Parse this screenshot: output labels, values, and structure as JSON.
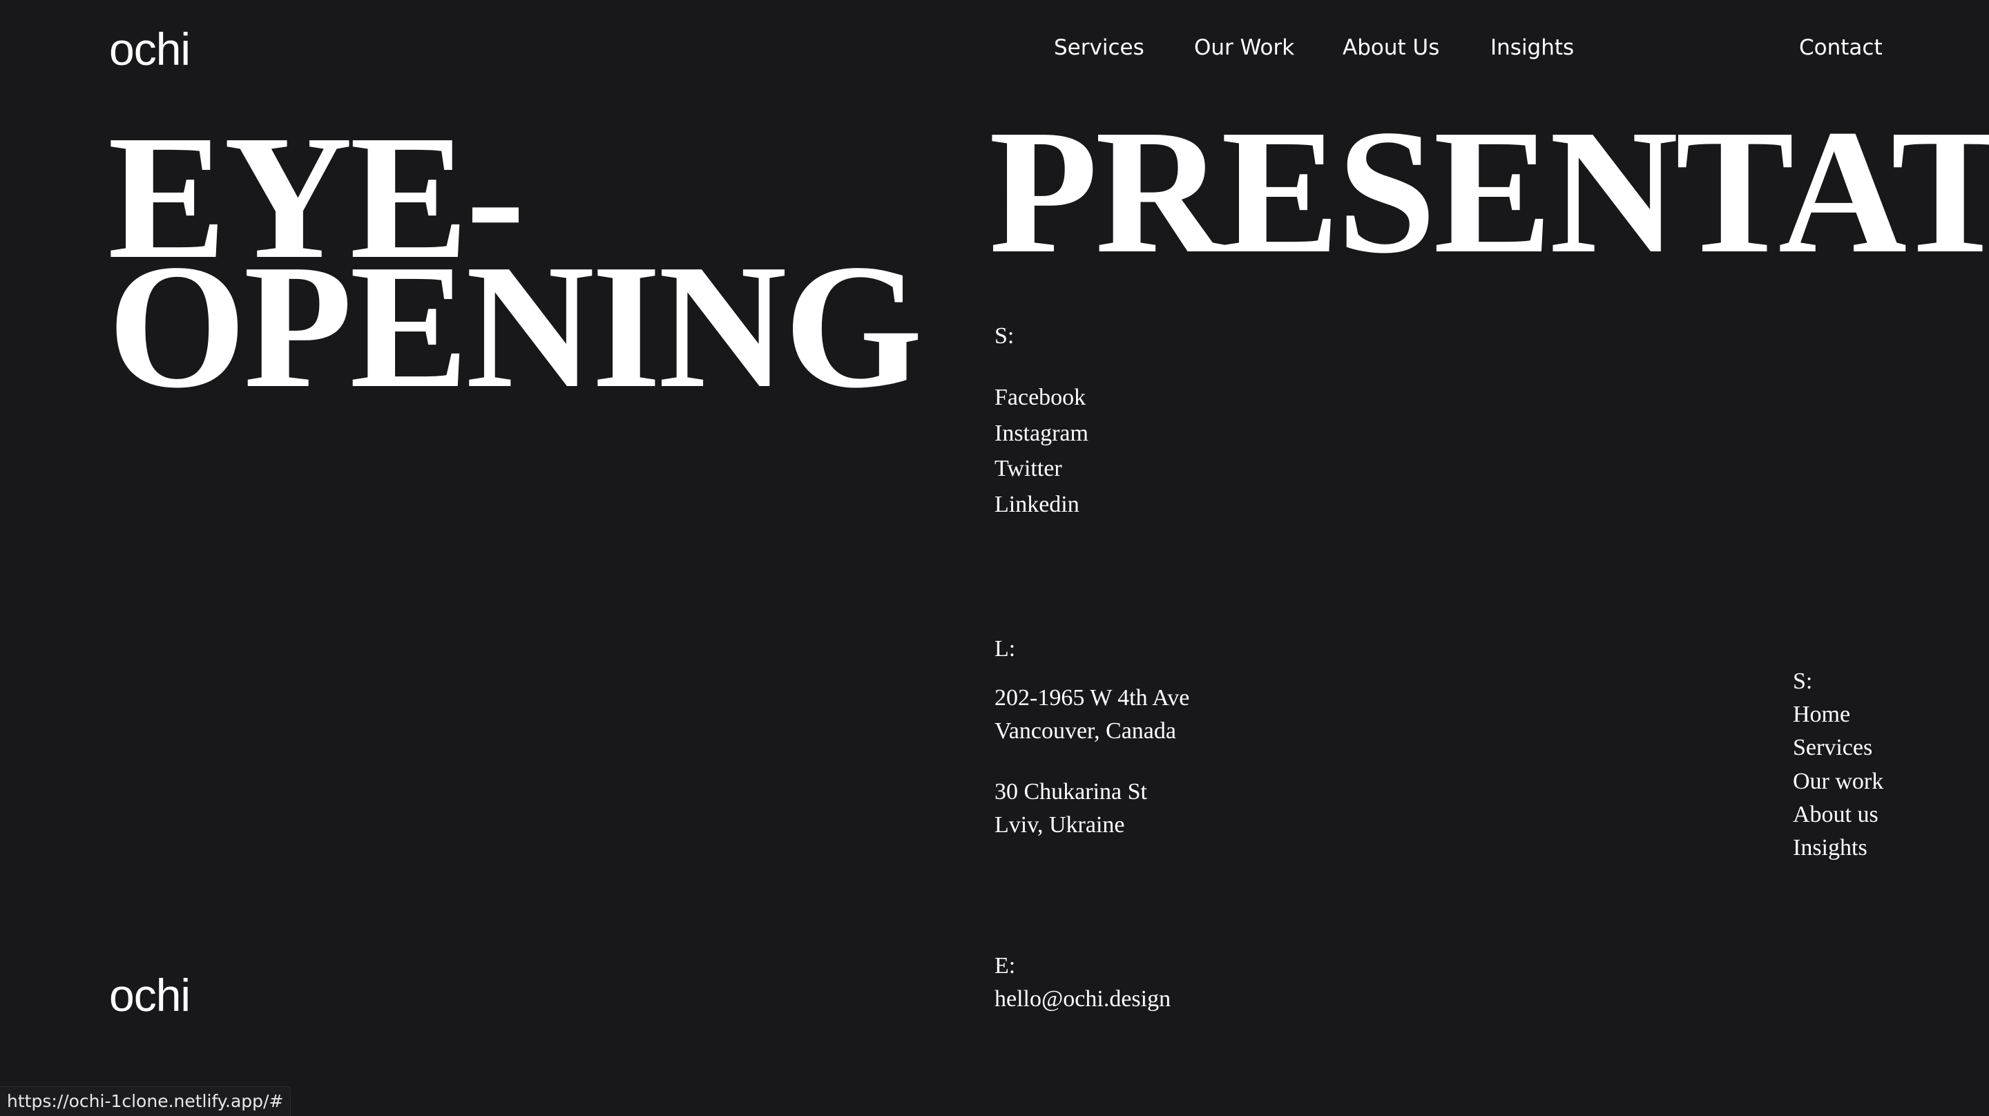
{
  "header": {
    "logo_text": "ochi",
    "nav": {
      "services": "Services",
      "our_work": "Our Work",
      "about_us": "About Us",
      "insights": "Insights",
      "contact": "Contact"
    }
  },
  "hero": {
    "line1": "EYE-",
    "line2": "OPENING",
    "line3": "PRESENTATI"
  },
  "footer": {
    "socials": {
      "label": "S:",
      "items": [
        "Facebook",
        "Instagram",
        "Twitter",
        "Linkedin"
      ]
    },
    "locations": {
      "label": "L:",
      "address1_line1": "202-1965 W 4th Ave",
      "address1_line2": "Vancouver, Canada",
      "address2_line1": "30 Chukarina St",
      "address2_line2": "Lviv, Ukraine"
    },
    "email": {
      "label": "E:",
      "value": "hello@ochi.design"
    },
    "sitemap": {
      "label": "S:",
      "items": [
        "Home",
        "Services",
        "Our work",
        "About us",
        "Insights"
      ]
    },
    "logo_text": "ochi"
  },
  "status_bar": {
    "url": "https://ochi-1clone.netlify.app/#"
  },
  "colors": {
    "background": "#18181a",
    "text": "#ffffff"
  }
}
